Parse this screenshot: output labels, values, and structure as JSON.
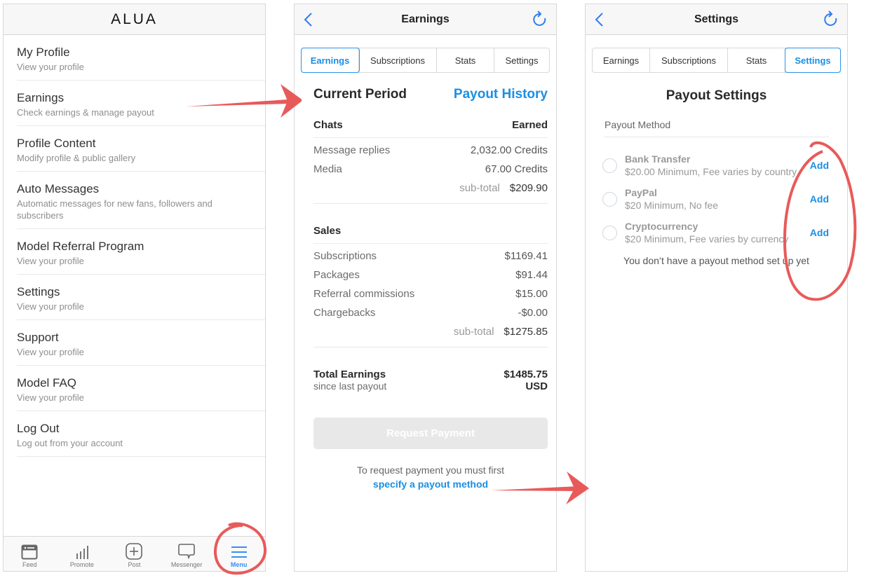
{
  "menu_screen": {
    "brand": "ALUA",
    "items": [
      {
        "title": "My Profile",
        "subtitle": "View your profile"
      },
      {
        "title": "Earnings",
        "subtitle": "Check earnings & manage payout"
      },
      {
        "title": "Profile Content",
        "subtitle": "Modify  profile & public gallery"
      },
      {
        "title": "Auto Messages",
        "subtitle": "Automatic messages for new fans, followers and subscribers"
      },
      {
        "title": "Model Referral Program",
        "subtitle": "View your profile"
      },
      {
        "title": "Settings",
        "subtitle": "View your profile"
      },
      {
        "title": "Support",
        "subtitle": "View your profile"
      },
      {
        "title": "Model FAQ",
        "subtitle": "View your profile"
      },
      {
        "title": "Log Out",
        "subtitle": "Log out from your account"
      }
    ],
    "tabbar": [
      {
        "label": "Feed",
        "icon": "feed-icon"
      },
      {
        "label": "Promote",
        "icon": "bar-chart-icon"
      },
      {
        "label": "Post",
        "icon": "plus-square-icon"
      },
      {
        "label": "Messenger",
        "icon": "chat-bubble-icon"
      },
      {
        "label": "Menu",
        "icon": "hamburger-menu-icon",
        "active": true
      }
    ]
  },
  "earnings_screen": {
    "title": "Earnings",
    "tabs": [
      "Earnings",
      "Subscriptions",
      "Stats",
      "Settings"
    ],
    "active_tab": "Earnings",
    "period_title": "Current Period",
    "payout_history_link": "Payout History",
    "chats": {
      "header": "Chats",
      "header_right": "Earned",
      "rows": [
        {
          "label": "Message replies",
          "value": "2,032.00 Credits"
        },
        {
          "label": "Media",
          "value": "67.00 Credits"
        }
      ],
      "subtotal_label": "sub-total",
      "subtotal_value": "$209.90"
    },
    "sales": {
      "header": "Sales",
      "rows": [
        {
          "label": "Subscriptions",
          "value": "$1169.41"
        },
        {
          "label": "Packages",
          "value": "$91.44"
        },
        {
          "label": "Referral commissions",
          "value": "$15.00"
        },
        {
          "label": "Chargebacks",
          "value": "-$0.00"
        }
      ],
      "subtotal_label": "sub-total",
      "subtotal_value": "$1275.85"
    },
    "total": {
      "label": "Total Earnings",
      "sublabel": "since last payout",
      "value": "$1485.75",
      "currency": "USD"
    },
    "request_button": "Request Payment",
    "hint_text": "To request payment you must first",
    "hint_link": "specify a payout method"
  },
  "settings_screen": {
    "title": "Settings",
    "tabs": [
      "Earnings",
      "Subscriptions",
      "Stats",
      "Settings"
    ],
    "active_tab": "Settings",
    "heading": "Payout Settings",
    "method_label": "Payout Method",
    "methods": [
      {
        "name": "Bank Transfer",
        "detail": "$20.00 Minimum, Fee varies by country",
        "action": "Add"
      },
      {
        "name": "PayPal",
        "detail": "$20 Minimum, No fee",
        "action": "Add"
      },
      {
        "name": "Cryptocurrency",
        "detail": "$20 Minimum, Fee varies by currency",
        "action": "Add"
      }
    ],
    "empty_message": "You don’t have a payout method set up yet"
  },
  "colors": {
    "accent": "#1a8fe3",
    "annotation": "#e85a5a",
    "disabled_button": "#e8e8e8"
  }
}
